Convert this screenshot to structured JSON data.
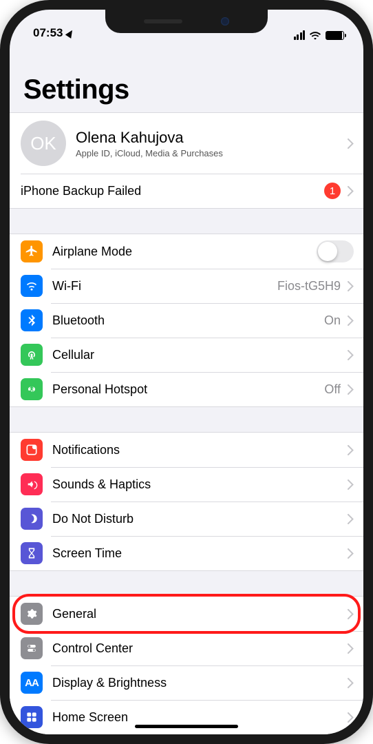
{
  "status": {
    "time": "07:53"
  },
  "header": {
    "title": "Settings"
  },
  "profile": {
    "initials": "OK",
    "name": "Olena Kahujova",
    "subtitle": "Apple ID, iCloud, Media & Purchases"
  },
  "backup": {
    "label": "iPhone Backup Failed",
    "badge": "1"
  },
  "net": {
    "airplane": {
      "label": "Airplane Mode",
      "on": false
    },
    "wifi": {
      "label": "Wi-Fi",
      "detail": "Fios-tG5H9"
    },
    "bt": {
      "label": "Bluetooth",
      "detail": "On"
    },
    "cell": {
      "label": "Cellular"
    },
    "hotspot": {
      "label": "Personal Hotspot",
      "detail": "Off"
    }
  },
  "alerts": {
    "notif": {
      "label": "Notifications"
    },
    "sounds": {
      "label": "Sounds & Haptics"
    },
    "dnd": {
      "label": "Do Not Disturb"
    },
    "st": {
      "label": "Screen Time"
    }
  },
  "gen": {
    "general": {
      "label": "General"
    },
    "cc": {
      "label": "Control Center"
    },
    "display": {
      "label": "Display & Brightness",
      "iconText": "AA"
    },
    "home": {
      "label": "Home Screen"
    }
  },
  "highlight": "general"
}
